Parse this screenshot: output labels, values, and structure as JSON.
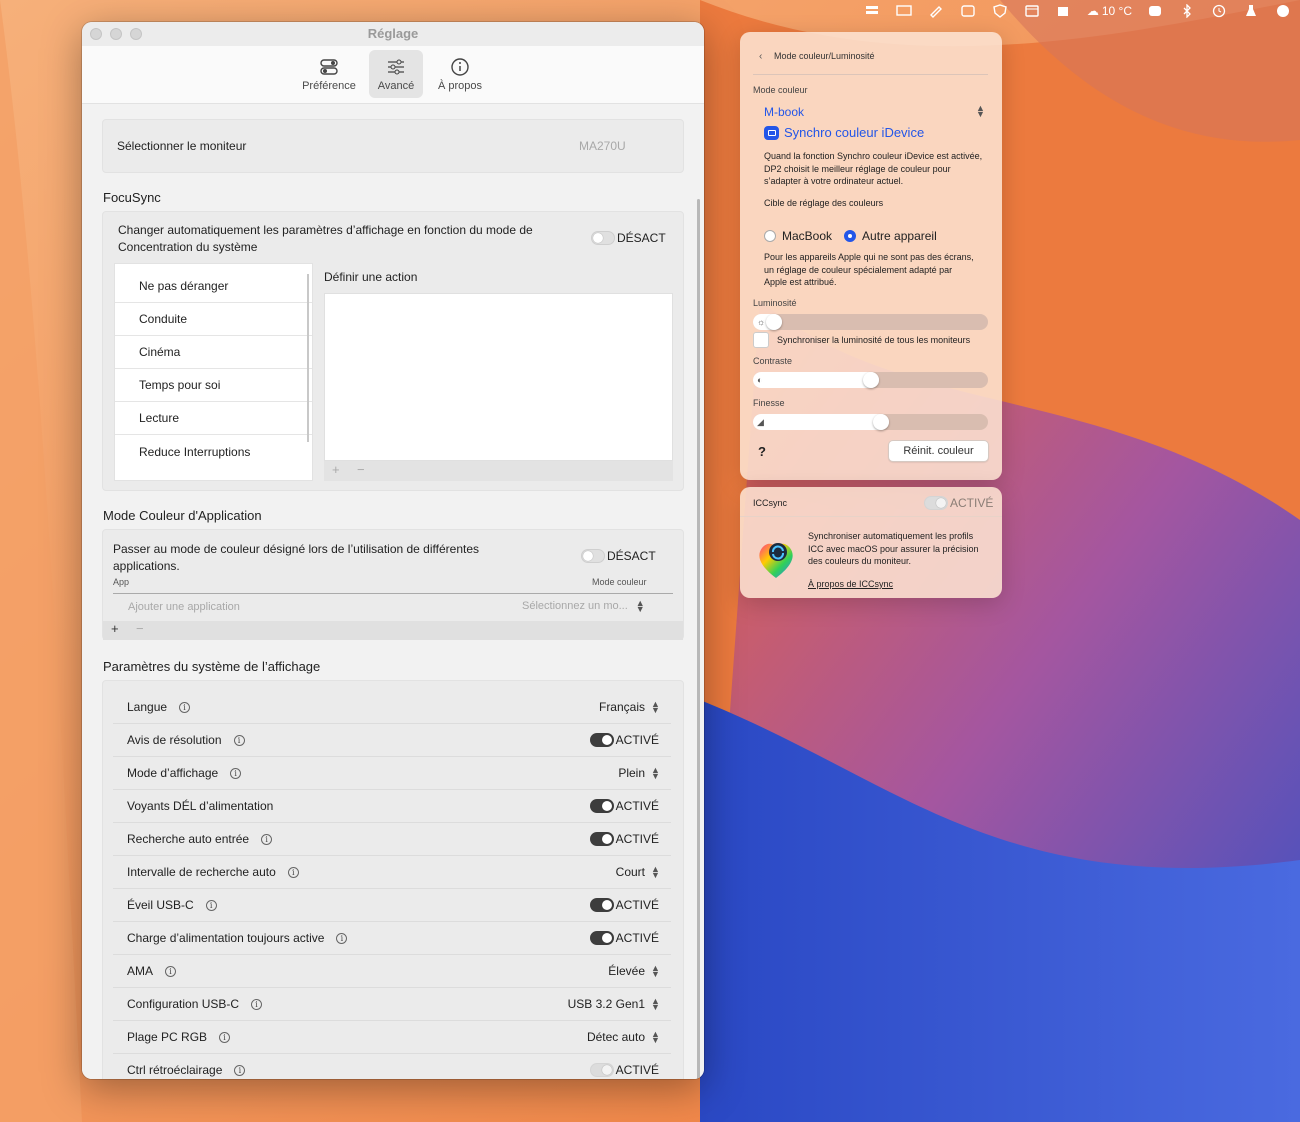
{
  "menubar": {
    "weather": "10 °C"
  },
  "window": {
    "title": "Réglage",
    "tabs": [
      {
        "label": "Préférence",
        "icon": "toggles-icon"
      },
      {
        "label": "Avancé",
        "icon": "sliders-icon"
      },
      {
        "label": "À propos",
        "icon": "info-icon"
      }
    ],
    "active_tab": "Avancé"
  },
  "monitor": {
    "label": "Sélectionner le moniteur",
    "value": "MA270U"
  },
  "focusync": {
    "title": "FocuSync",
    "description": "Changer automatiquement les paramètres d’affichage en fonction du mode de Concentration du système",
    "toggle_label": "DÉSACT",
    "modes": [
      "Ne pas déranger",
      "Conduite",
      "Cinéma",
      "Temps pour soi",
      "Lecture",
      "Reduce Interruptions"
    ],
    "action_title": "Définir une action",
    "add": "+",
    "remove": "−"
  },
  "app_color": {
    "title": "Mode Couleur d'Application",
    "description": "Passer au mode de couleur désigné lors de l’utilisation de différentes applications.",
    "toggle_label": "DÉSACT",
    "col_app": "App",
    "col_mode": "Mode couleur",
    "add_placeholder": "Ajouter une application",
    "select_placeholder": "Sélectionnez un mo...",
    "add": "+",
    "remove": "−"
  },
  "system": {
    "title": "Paramètres du système de l’affichage",
    "rows": [
      {
        "label": "Langue",
        "value": "Français",
        "kind": "select"
      },
      {
        "label": "Avis de résolution",
        "value": "ACTIVÉ",
        "kind": "toggle"
      },
      {
        "label": "Mode d’affichage",
        "value": "Plein",
        "kind": "select"
      },
      {
        "label": "Voyants DÉL d’alimentation",
        "value": "ACTIVÉ",
        "kind": "toggle"
      },
      {
        "label": "Recherche auto entrée",
        "value": "ACTIVÉ",
        "kind": "toggle"
      },
      {
        "label": "Intervalle de recherche auto",
        "value": "Court",
        "kind": "select"
      },
      {
        "label": "Éveil USB-C",
        "value": "ACTIVÉ",
        "kind": "toggle"
      },
      {
        "label": "Charge d’alimentation toujours active",
        "value": "ACTIVÉ",
        "kind": "toggle"
      },
      {
        "label": "AMA",
        "value": "Élevée",
        "kind": "select"
      },
      {
        "label": "Configuration USB-C",
        "value": "USB 3.2 Gen1",
        "kind": "select"
      },
      {
        "label": "Plage PC RGB",
        "value": "Détec auto",
        "kind": "select"
      },
      {
        "label": "Ctrl rétroéclairage",
        "value": "ACTIVÉ",
        "kind": "toggle-dim"
      }
    ]
  },
  "color_panel": {
    "breadcrumb": "Mode couleur/Luminosité",
    "mode_label": "Mode couleur",
    "mode_value": "M-book",
    "sync_title": "Synchro couleur iDevice",
    "sync_desc": "Quand la fonction Synchro couleur iDevice est activée, DP2 choisit le meilleur réglage de couleur pour s’adapter à votre ordinateur actuel.",
    "target_label": "Cible de réglage des couleurs",
    "option_macbook": "MacBook",
    "option_other": "Autre appareil",
    "selected_option": "Autre appareil",
    "other_desc": "Pour les appareils Apple qui ne sont pas des écrans, un réglage de couleur spécialement adapté par Apple est attribué.",
    "brightness_label": "Luminosité",
    "brightness_value": 0.06,
    "sync_brightness": "Synchroniser la luminosité de tous les moniteurs",
    "contrast_label": "Contraste",
    "contrast_value": 0.5,
    "sharpness_label": "Finesse",
    "sharpness_value": 0.55,
    "help": "?",
    "reset": "Réinit. couleur"
  },
  "icc_panel": {
    "title": "ICCsync",
    "toggle_label": "ACTIVÉ",
    "desc": "Synchroniser automatiquement les profils ICC avec macOS pour assurer la précision des couleurs du moniteur.",
    "link": "À propos de ICCsync"
  }
}
